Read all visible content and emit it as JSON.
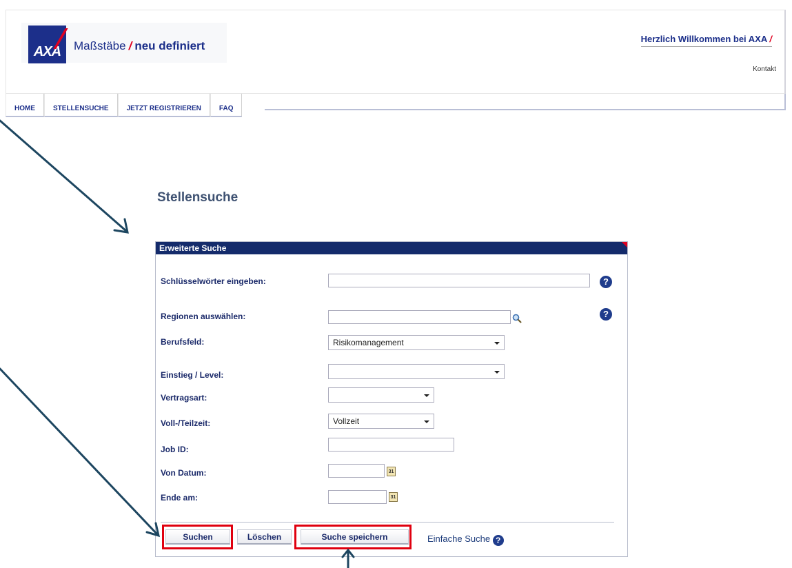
{
  "header": {
    "logo_text": "AXA",
    "tagline_part1": "Maßstäbe",
    "tagline_part2": "neu definiert",
    "welcome": "Herzlich Willkommen bei AXA",
    "contact": "Kontakt"
  },
  "nav": {
    "items": [
      {
        "label": "HOME"
      },
      {
        "label": "STELLENSUCHE"
      },
      {
        "label": "JETZT REGISTRIEREN"
      },
      {
        "label": "FAQ"
      }
    ]
  },
  "page_title": "Stellensuche",
  "panel": {
    "title": "Erweiterte Suche",
    "fields": {
      "keywords_label": "Schlüsselwörter eingeben:",
      "keywords_value": "",
      "regions_label": "Regionen auswählen:",
      "regions_value": "",
      "field_label": "Berufsfeld:",
      "field_value": "Risikomanagement",
      "level_label": "Einstieg / Level:",
      "level_value": "",
      "contract_label": "Vertragsart:",
      "contract_value": "",
      "time_label": "Voll-/Teilzeit:",
      "time_value": "Vollzeit",
      "jobid_label": "Job ID:",
      "jobid_value": "",
      "from_label": "Von Datum:",
      "from_value": "",
      "end_label": "Ende am:",
      "end_value": ""
    },
    "calendar_icon_text": "31",
    "help_icon_text": "?",
    "buttons": {
      "search": "Suchen",
      "clear": "Löschen",
      "save": "Suche speichern",
      "simple": "Einfache Suche"
    }
  },
  "icons": {
    "help": "question-circle-icon",
    "search": "magnifier-icon",
    "calendar": "calendar-icon"
  },
  "colors": {
    "brand_blue": "#1c2f8a",
    "brand_red": "#e00020",
    "panel_header": "#142b6b",
    "highlight": "#e0000f",
    "annotation_arrow": "#1d4660"
  }
}
